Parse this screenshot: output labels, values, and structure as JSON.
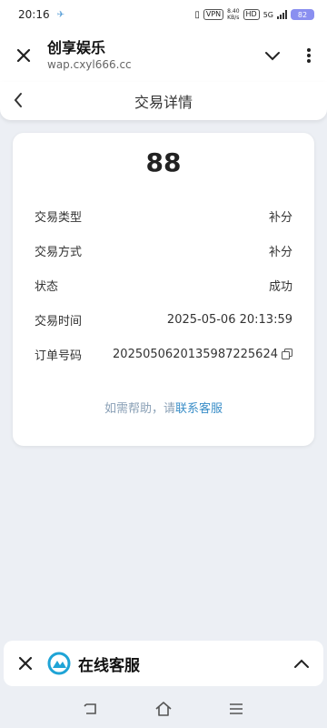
{
  "status_bar": {
    "time": "20:16",
    "vpn_label": "VPN",
    "speed": "8.40\nKB/s",
    "hd_label": "HD",
    "network": "5G",
    "battery": "82"
  },
  "browser": {
    "site_name": "创享娱乐",
    "url": "wap.cxyl666.cc"
  },
  "header": {
    "title": "交易详情"
  },
  "transaction": {
    "amount": "88",
    "rows": [
      {
        "label": "交易类型",
        "value": "补分"
      },
      {
        "label": "交易方式",
        "value": "补分"
      },
      {
        "label": "状态",
        "value": "成功"
      },
      {
        "label": "交易时间",
        "value": "2025-05-06 20:13:59"
      },
      {
        "label": "订单号码",
        "value": "20250506201359872256​24"
      }
    ]
  },
  "help": {
    "prefix": "如需帮助，请",
    "link": "联系客服"
  },
  "customer_service": {
    "title": "在线客服"
  },
  "colors": {
    "background": "#eceff4",
    "link": "#3a8ec8",
    "battery": "#8a8ff0",
    "logo": "#1fa4d6"
  }
}
